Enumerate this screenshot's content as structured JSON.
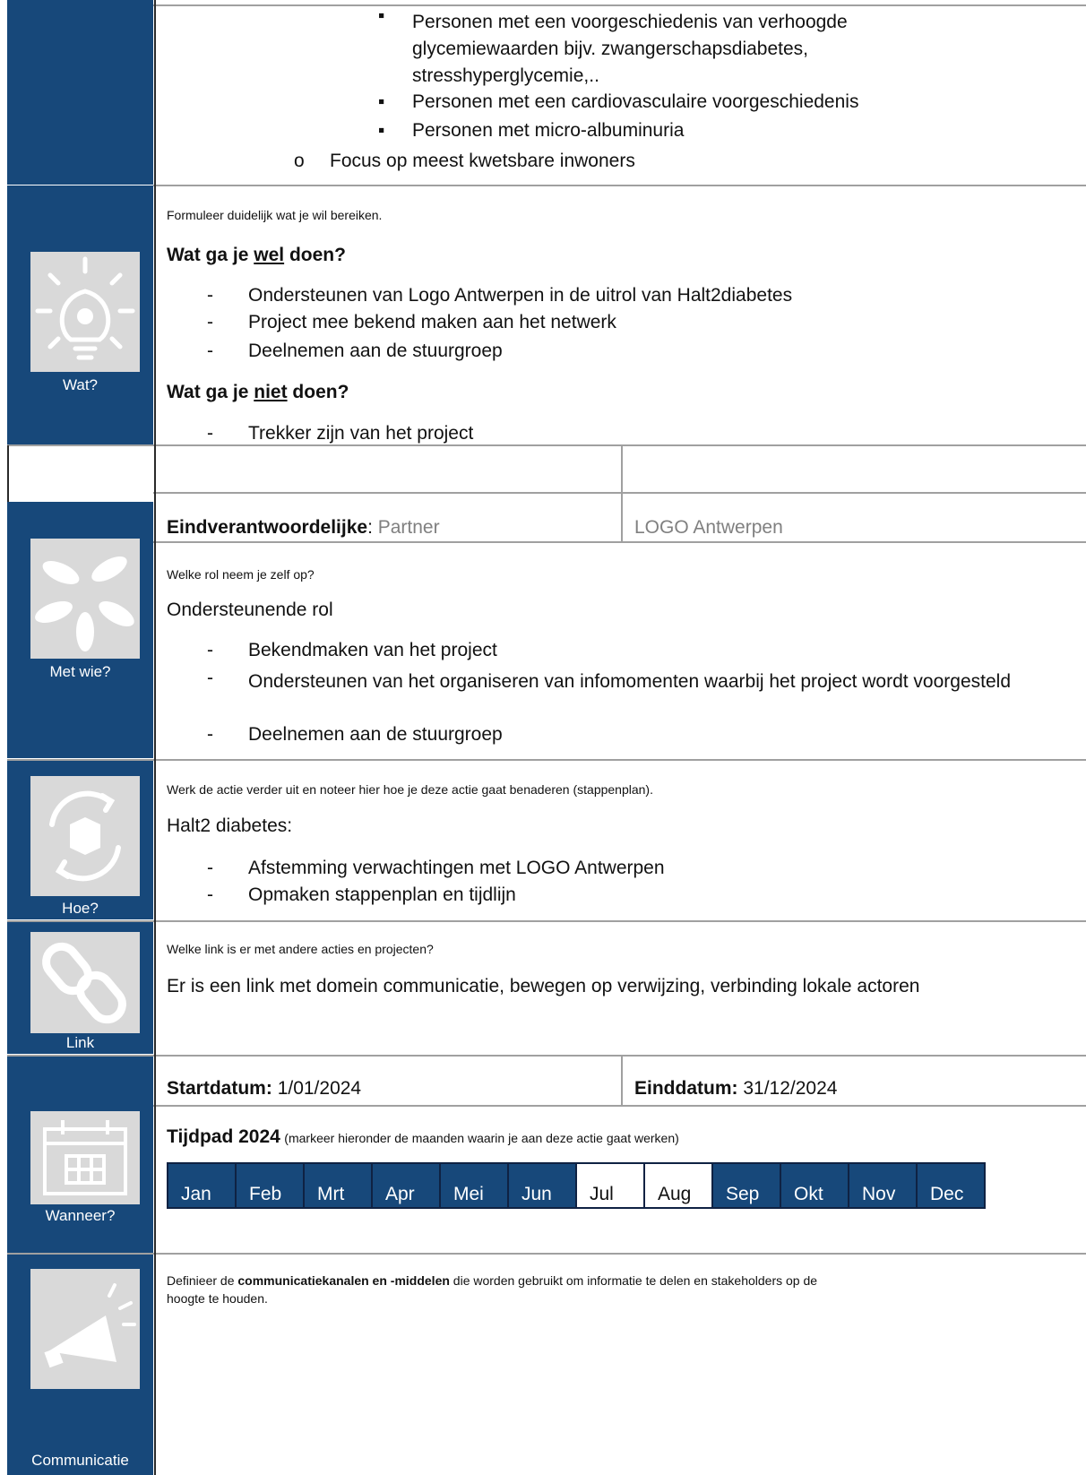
{
  "target_group": {
    "subitems": [
      "Personen met een voorgeschiedenis van verhoogde glycemiewaarden bijv. zwangerschapsdiabetes, stresshyperglycemie,..",
      "Personen met een cardiovasculaire voorgeschiedenis",
      "Personen met micro-albuminuria"
    ],
    "focus_marker": "o",
    "focus": "Focus op meest kwetsbare inwoners"
  },
  "wat": {
    "sidebar_label": "Wat?",
    "intro": "Formuleer duidelijk wat je wil bereiken.",
    "wel_heading_pre": "Wat ga je ",
    "wel_heading_key": "wel",
    "wel_heading_post": " doen?",
    "wel_items": [
      "Ondersteunen van Logo Antwerpen in de uitrol van Halt2diabetes",
      "Project mee bekend maken aan het netwerk",
      "Deelnemen aan de stuurgroep"
    ],
    "niet_heading_pre": "Wat ga je ",
    "niet_heading_key": "niet",
    "niet_heading_post": " doen?",
    "niet_items": [
      "Trekker zijn van het project"
    ]
  },
  "met_wie": {
    "sidebar_label": "Met wie?",
    "eind_label": "Eindverantwoordelijke",
    "eind_value": "Partner",
    "partner_name": "LOGO Antwerpen",
    "role_question": "Welke rol neem je zelf op?",
    "role": "Ondersteunende rol",
    "items": [
      "Bekendmaken van het project",
      "Ondersteunen van het organiseren van infomomenten waarbij het project wordt voorgesteld",
      "Deelnemen aan de stuurgroep"
    ]
  },
  "hoe": {
    "sidebar_label": "Hoe?",
    "intro": "Werk de actie verder uit en noteer hier hoe je deze actie gaat benaderen (stappenplan).",
    "title": "Halt2 diabetes:",
    "items": [
      "Afstemming verwachtingen met LOGO Antwerpen",
      "Opmaken stappenplan en tijdlijn"
    ]
  },
  "link": {
    "sidebar_label": "Link",
    "question": "Welke link is er met andere acties en projecten?",
    "text": "Er is een link met domein communicatie, bewegen op verwijzing, verbinding lokale actoren"
  },
  "wanneer": {
    "sidebar_label": "Wanneer?",
    "start_label": "Startdatum:",
    "start_value": "1/01/2024",
    "end_label": "Einddatum:",
    "end_value": "31/12/2024",
    "tijdpad_label": "Tijdpad 2024",
    "tijdpad_note": "(markeer hieronder de maanden waarin je aan deze actie gaat werken)",
    "months": [
      {
        "label": "Jan",
        "active": true
      },
      {
        "label": "Feb",
        "active": true
      },
      {
        "label": "Mrt",
        "active": true
      },
      {
        "label": "Apr",
        "active": true
      },
      {
        "label": "Mei",
        "active": true
      },
      {
        "label": "Jun",
        "active": true
      },
      {
        "label": "Jul",
        "active": false
      },
      {
        "label": "Aug",
        "active": false
      },
      {
        "label": "Sep",
        "active": true
      },
      {
        "label": "Okt",
        "active": true
      },
      {
        "label": "Nov",
        "active": true
      },
      {
        "label": "Dec",
        "active": true
      }
    ]
  },
  "communicatie": {
    "sidebar_label": "Communicatie",
    "text_pre": "Definieer de ",
    "text_bold": "communicatiekanalen en -middelen",
    "text_post1": " die worden gebruikt om informatie te delen en stakeholders op de",
    "text_post2": "hoogte te houden."
  },
  "colors": {
    "sidebar": "#17487a",
    "month_active": "#17487a",
    "month_border": "#0f2243",
    "icon_bg": "#d9d9d9",
    "rule": "#a0a0a0"
  },
  "icons": [
    "lightbulb-gear-icon",
    "hands-circle-icon",
    "box-cycle-icon",
    "chain-link-icon",
    "calendar-icon",
    "megaphone-icon"
  ]
}
